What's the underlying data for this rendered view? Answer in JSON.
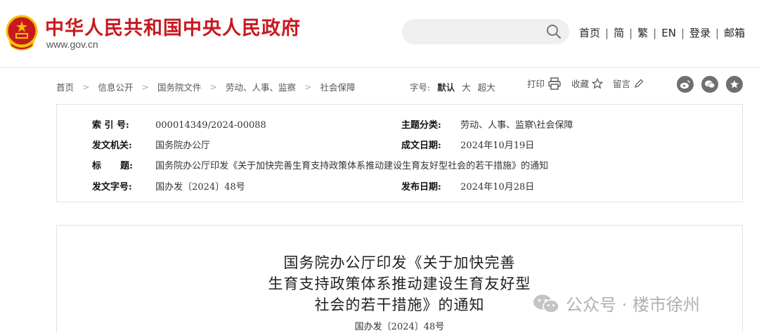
{
  "header": {
    "site_title": "中华人民共和国中央人民政府",
    "site_url": "www.gov.cn",
    "search_placeholder": "",
    "nav": [
      "首页",
      "简",
      "繁",
      "EN",
      "登录",
      "邮箱"
    ]
  },
  "breadcrumb": {
    "items": [
      "首页",
      "信息公开",
      "国务院文件",
      "劳动、人事、监察",
      "社会保障"
    ]
  },
  "font_size": {
    "label": "字号:",
    "options": [
      "默认",
      "大",
      "超大"
    ],
    "selected": "默认"
  },
  "actions": {
    "print": "打印",
    "favorite": "收藏",
    "comment": "留言"
  },
  "share": [
    "weibo-icon",
    "wechat-icon",
    "star-icon"
  ],
  "meta": {
    "index_label": "索 引 号:",
    "index_value": "000014349/2024-00088",
    "category_label": "主题分类:",
    "category_value": "劳动、人事、监察\\社会保障",
    "issuer_label": "发文机关:",
    "issuer_value": "国务院办公厅",
    "written_date_label": "成文日期:",
    "written_date_value": "2024年10月19日",
    "title_label": "标      题:",
    "title_value": "国务院办公厅印发《关于加快完善生育支持政策体系推动建设生育友好型社会的若干措施》的通知",
    "doc_no_label": "发文字号:",
    "doc_no_value": "国办发〔2024〕48号",
    "publish_date_label": "发布日期:",
    "publish_date_value": "2024年10月28日"
  },
  "document": {
    "title_lines": [
      "国务院办公厅印发《关于加快完善",
      "生育支持政策体系推动建设生育友好型",
      "社会的若干措施》的通知"
    ],
    "doc_number": "国办发〔2024〕48号"
  },
  "watermark": {
    "text": "公众号 · 楼市徐州"
  },
  "colors": {
    "brand_red": "#c8191f",
    "emblem_gold": "#f2c200",
    "icon_gray": "#6f6f6f"
  }
}
